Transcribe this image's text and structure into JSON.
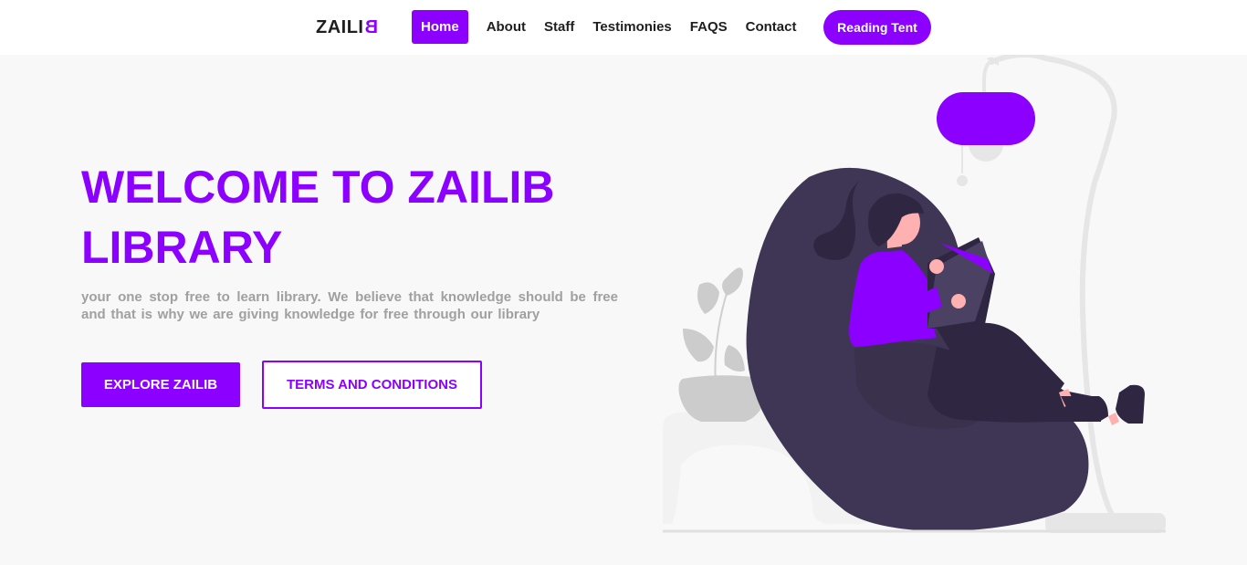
{
  "brand": {
    "logo_prefix": "ZAILI",
    "logo_mirrored": "B",
    "accent": "#8b00ff"
  },
  "nav": {
    "items": [
      {
        "label": "Home",
        "active": true
      },
      {
        "label": "About"
      },
      {
        "label": "Staff"
      },
      {
        "label": "Testimonies"
      },
      {
        "label": "FAQS"
      },
      {
        "label": "Contact"
      }
    ],
    "cta_label": "Reading Tent"
  },
  "hero": {
    "title_line1": "WELCOME TO ZAILIB",
    "title_line2": "LIBRARY",
    "subtitle": "your one stop free to learn library. We believe that knowledge should be free and that is why we are giving knowledge for free through our library",
    "primary_button": "EXPLORE ZAILIB",
    "secondary_button": "TERMS AND CONDITIONS"
  },
  "illustration": {
    "name": "woman-reading-on-beanbag-illustration"
  }
}
